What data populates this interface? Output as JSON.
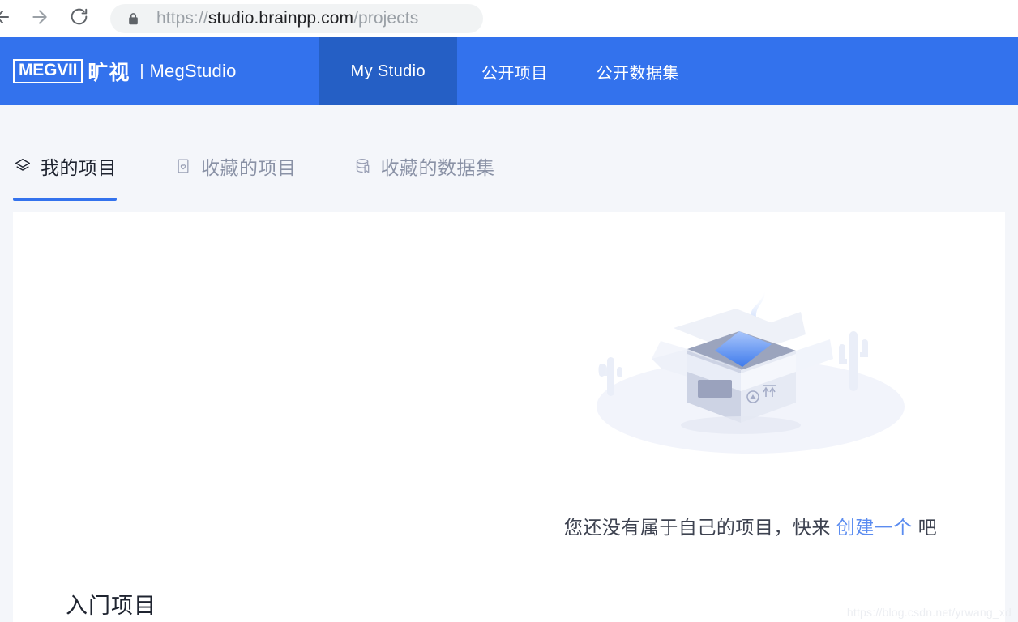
{
  "browser": {
    "back_icon": "arrow-left-icon",
    "forward_icon": "arrow-right-icon",
    "reload_icon": "reload-icon",
    "lock_icon": "lock-icon",
    "url_prefix": "https://",
    "url_host": "studio.brainpp.com",
    "url_path": "/projects",
    "url_full": "https://studio.brainpp.com/projects"
  },
  "header": {
    "logo_mark": "MEGVII",
    "logo_cn": "旷视",
    "separator": "|",
    "product": "MegStudio",
    "accent_blue": "#3372ed",
    "accent_blue_active": "#255fc5",
    "nav": [
      {
        "label": "My Studio",
        "active": true
      },
      {
        "label": "公开项目",
        "active": false
      },
      {
        "label": "公开数据集",
        "active": false
      }
    ]
  },
  "subtabs": [
    {
      "label": "我的项目",
      "icon": "layers-icon",
      "active": true
    },
    {
      "label": "收藏的项目",
      "icon": "bookmark-heart-icon",
      "active": false
    },
    {
      "label": "收藏的数据集",
      "icon": "database-bookmark-icon",
      "active": false
    }
  ],
  "empty_state": {
    "illustration": "empty-open-box-illustration",
    "text_before": "您还没有属于自己的项目，快来",
    "link_text": "创建一个",
    "text_after": "吧"
  },
  "starter_section": {
    "title": "入门项目"
  },
  "watermark": {
    "text": "https://blog.csdn.net/yrwang_xd"
  },
  "colors": {
    "page_bg": "#f4f6fa",
    "card_bg": "#ffffff",
    "link_blue": "#5b8cf0",
    "tab_underline": "#3372ed",
    "muted_text": "#8a92a6"
  }
}
